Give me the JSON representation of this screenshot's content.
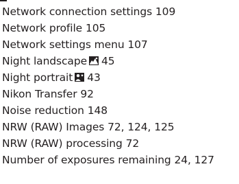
{
  "index": {
    "entries": [
      {
        "term": "Network connection settings",
        "pages": "109"
      },
      {
        "term": "Network profile",
        "pages": "105"
      },
      {
        "term": "Network settings menu",
        "pages": "107"
      },
      {
        "term": "Night landscape",
        "icon": "night-landscape-icon",
        "pages": "45"
      },
      {
        "term": "Night portrait",
        "icon": "night-portrait-icon",
        "pages": "43"
      },
      {
        "term": "Nikon Transfer",
        "pages": "92"
      },
      {
        "term": "Noise reduction",
        "pages": "148"
      },
      {
        "term": "NRW (RAW) Images",
        "pages": "72, 124, 125"
      },
      {
        "term": "NRW (RAW) processing",
        "pages": "72"
      },
      {
        "term": "Number of exposures remaining",
        "pages": "24, 127"
      }
    ]
  }
}
